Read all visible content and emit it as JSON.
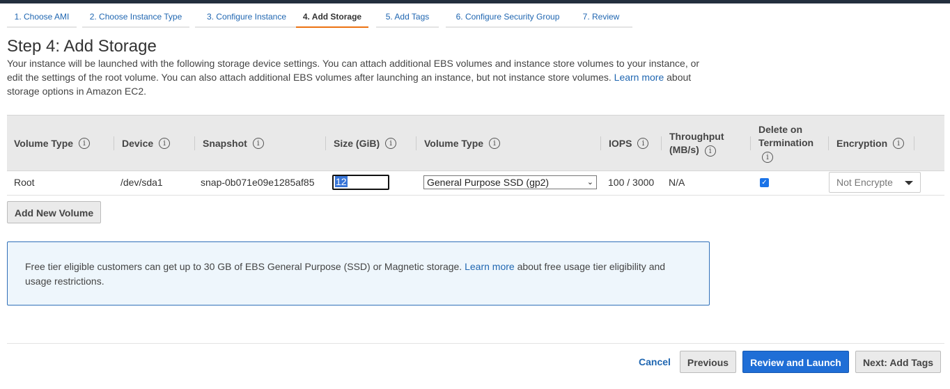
{
  "wizard": {
    "steps": [
      "1. Choose AMI",
      "2. Choose Instance Type",
      "3. Configure Instance",
      "4. Add Storage",
      "5. Add Tags",
      "6. Configure Security Group",
      "7. Review"
    ],
    "active_step": 3
  },
  "page": {
    "title": "Step 4: Add Storage",
    "description_1": "Your instance will be launched with the following storage device settings. You can attach additional EBS volumes and instance store volumes to your instance, or edit the settings of the root volume. You can also attach additional EBS volumes after launching an instance, but not instance store volumes.",
    "learn_more": "Learn more",
    "description_2": "about storage options in Amazon EC2."
  },
  "table": {
    "headers": {
      "volume_type": "Volume Type",
      "device": "Device",
      "snapshot": "Snapshot",
      "size": "Size (GiB)",
      "volume_type2": "Volume Type",
      "iops": "IOPS",
      "throughput_1": "Throughput",
      "throughput_2": "(MB/s)",
      "delete_1": "Delete on",
      "delete_2": "Termination",
      "encryption": "Encryption"
    },
    "info_glyph": "i",
    "row": {
      "volume_type": "Root",
      "device": "/dev/sda1",
      "snapshot": "snap-0b071e09e1285af85",
      "size": "12",
      "volume_type_select": "General Purpose SSD (gp2)",
      "iops": "100 / 3000",
      "throughput": "N/A",
      "delete_on_termination": true,
      "encryption": "Not Encrypte"
    }
  },
  "buttons": {
    "add_volume": "Add New Volume",
    "cancel": "Cancel",
    "previous": "Previous",
    "review_launch": "Review and Launch",
    "next": "Next: Add Tags"
  },
  "alert": {
    "text_1": "Free tier eligible customers can get up to 30 GB of EBS General Purpose (SSD) or Magnetic storage.",
    "learn_more": "Learn more",
    "text_2": "about free usage tier eligibility and usage restrictions."
  },
  "colors": {
    "accent_orange": "#ec7211",
    "primary_blue": "#1f6ed6",
    "link_blue": "#1f66b1"
  }
}
